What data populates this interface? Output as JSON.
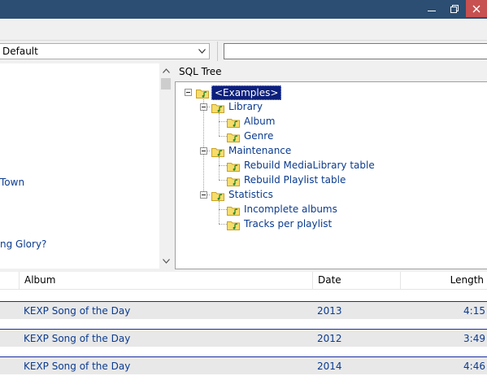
{
  "window": {
    "controls": {
      "minimize_icon": "minimize-icon",
      "maximize_icon": "restore-icon",
      "close_icon": "close-icon"
    }
  },
  "preset": {
    "selected": "Default"
  },
  "query": {
    "value": ""
  },
  "left_list": {
    "items": [
      "Town",
      "ng Glory?"
    ]
  },
  "sql_tree": {
    "header": "SQL Tree",
    "root": "<Examples>",
    "library": "Library",
    "album": "Album",
    "genre": "Genre",
    "maintenance": "Maintenance",
    "rebuild_media": "Rebuild MediaLibrary table",
    "rebuild_playlist": "Rebuild Playlist table",
    "statistics": "Statistics",
    "incomplete": "Incomplete albums",
    "tracks": "Tracks per playlist"
  },
  "grid": {
    "columns": [
      "Album",
      "Date",
      "Length"
    ],
    "rows": [
      {
        "album": "KEXP Song of the Day",
        "date": "2013",
        "length": "4:15"
      },
      {
        "album": "KEXP Song of the Day",
        "date": "2012",
        "length": "3:49"
      },
      {
        "album": "KEXP Song of the Day",
        "date": "2014",
        "length": "4:46"
      }
    ]
  },
  "colors": {
    "titlebar": "#2b4e72",
    "close": "#c75050",
    "link_text": "#0b3b8f",
    "selection": "#0c1f7a",
    "row_border": "#1a2f9e"
  }
}
